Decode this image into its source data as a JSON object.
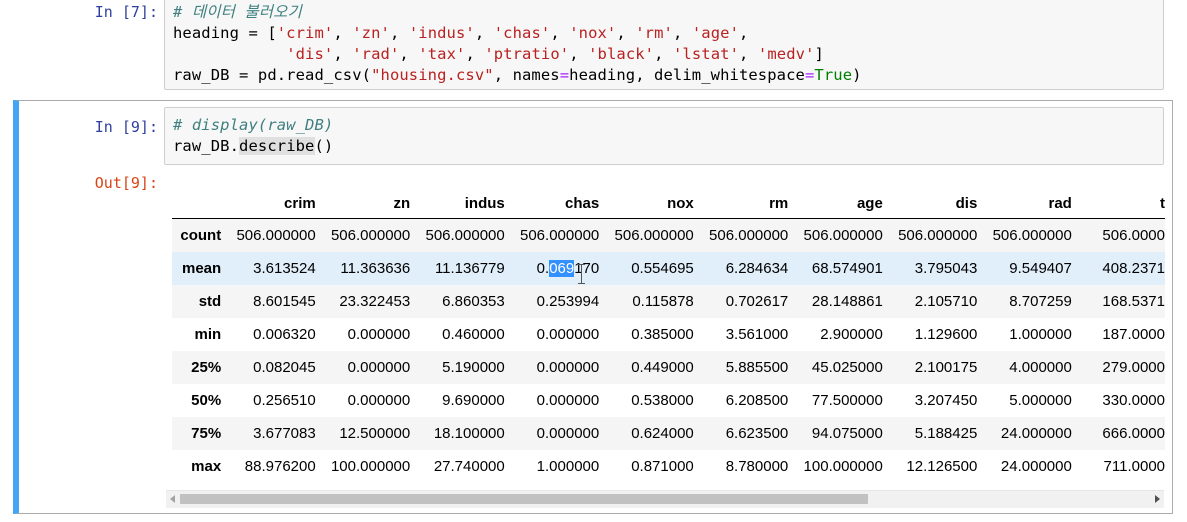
{
  "cell7": {
    "prompt": "In [7]:",
    "line1_comment": "# 데이터 불러오기",
    "line2_var": "heading = [",
    "line2_items": [
      "'crim'",
      "'zn'",
      "'indus'",
      "'chas'",
      "'nox'",
      "'rm'",
      "'age'"
    ],
    "line3_items": [
      "'dis'",
      "'rad'",
      "'tax'",
      "'ptratio'",
      "'black'",
      "'lstat'",
      "'medv'"
    ],
    "line4_pre": "raw_DB = pd.read_csv(",
    "line4_str": "\"housing.csv\"",
    "line4_mid": ", names",
    "line4_eq1": "=",
    "line4_mid2": "heading, delim_whitespace",
    "line4_eq2": "=",
    "line4_kw": "True",
    "line4_end": ")"
  },
  "cell9": {
    "prompt": "In [9]:",
    "line1_comment": "# display(raw_DB)",
    "line2_pre": "raw_DB.",
    "line2_method": "describe",
    "line2_end": "()",
    "out_prompt": "Out[9]:"
  },
  "table": {
    "columns": [
      "crim",
      "zn",
      "indus",
      "chas",
      "nox",
      "rm",
      "age",
      "dis",
      "rad",
      "t"
    ],
    "rows": [
      {
        "label": "count",
        "values": [
          "506.000000",
          "506.000000",
          "506.000000",
          "506.000000",
          "506.000000",
          "506.000000",
          "506.000000",
          "506.000000",
          "506.000000",
          "506.0000"
        ]
      },
      {
        "label": "mean",
        "values": [
          "3.613524",
          "11.363636",
          "11.136779",
          "0.069170",
          "0.554695",
          "6.284634",
          "68.574901",
          "3.795043",
          "9.549407",
          "408.2371"
        ]
      },
      {
        "label": "std",
        "values": [
          "8.601545",
          "23.322453",
          "6.860353",
          "0.253994",
          "0.115878",
          "0.702617",
          "28.148861",
          "2.105710",
          "8.707259",
          "168.5371"
        ]
      },
      {
        "label": "min",
        "values": [
          "0.006320",
          "0.000000",
          "0.460000",
          "0.000000",
          "0.385000",
          "3.561000",
          "2.900000",
          "1.129600",
          "1.000000",
          "187.0000"
        ]
      },
      {
        "label": "25%",
        "values": [
          "0.082045",
          "0.000000",
          "5.190000",
          "0.000000",
          "0.449000",
          "5.885500",
          "45.025000",
          "2.100175",
          "4.000000",
          "279.0000"
        ]
      },
      {
        "label": "50%",
        "values": [
          "0.256510",
          "0.000000",
          "9.690000",
          "0.000000",
          "0.538000",
          "6.208500",
          "77.500000",
          "3.207450",
          "5.000000",
          "330.0000"
        ]
      },
      {
        "label": "75%",
        "values": [
          "3.677083",
          "12.500000",
          "18.100000",
          "0.000000",
          "0.624000",
          "6.623500",
          "94.075000",
          "5.188425",
          "24.000000",
          "666.0000"
        ]
      },
      {
        "label": "max",
        "values": [
          "88.976200",
          "100.000000",
          "27.740000",
          "1.000000",
          "0.871000",
          "8.780000",
          "100.000000",
          "12.126500",
          "24.000000",
          "711.0000"
        ]
      }
    ],
    "selection": {
      "before": "0.",
      "selected": "069",
      "after": "170"
    }
  },
  "colors": {
    "selected_cell_bar": "#42a5f5",
    "input_prompt": "#303f9f",
    "output_prompt": "#d84315"
  }
}
